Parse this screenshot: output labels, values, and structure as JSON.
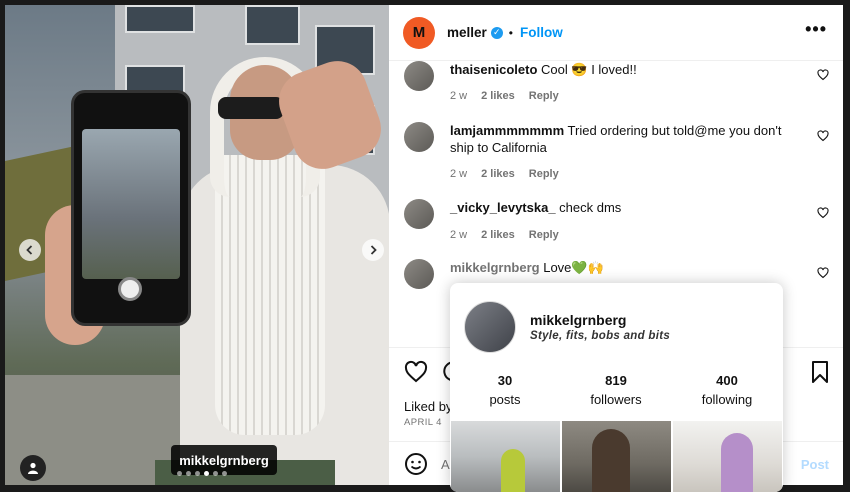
{
  "post": {
    "tagged_user": "mikkelgrnberg",
    "slide_count": 6,
    "active_slide": 4
  },
  "header": {
    "logo_letter": "M",
    "username": "meller",
    "verified": "✓",
    "dot": "•",
    "follow": "Follow",
    "more": "•••"
  },
  "comments": [
    {
      "user": "thaisenicoleto",
      "text": "Cool 😎 I loved!!",
      "age": "2 w",
      "likes": "2 likes",
      "reply": "Reply"
    },
    {
      "user": "lamjammmmmmm",
      "text": "Tried ordering but told@me you don't ship to California",
      "age": "2 w",
      "likes": "2 likes",
      "reply": "Reply"
    },
    {
      "user": "_vicky_levytska_",
      "text": "check dms",
      "age": "2 w",
      "likes": "2 likes",
      "reply": "Reply"
    },
    {
      "user": "mikkelgrnberg",
      "text": "Love💚🙌"
    }
  ],
  "footer": {
    "liked_by": "Liked by",
    "date": "APRIL 4",
    "add_comment_placeholder": "A",
    "post": "Post"
  },
  "hover_card": {
    "username": "mikkelgrnberg",
    "bio": "Style, fits, bobs and bits",
    "stats": [
      {
        "value": "30",
        "label": "posts"
      },
      {
        "value": "819",
        "label": "followers"
      },
      {
        "value": "400",
        "label": "following"
      }
    ]
  },
  "colors": {
    "follow": "#0095f6",
    "logo": "#f05a24",
    "verified": "#1d9bf0",
    "muted": "#737373"
  }
}
